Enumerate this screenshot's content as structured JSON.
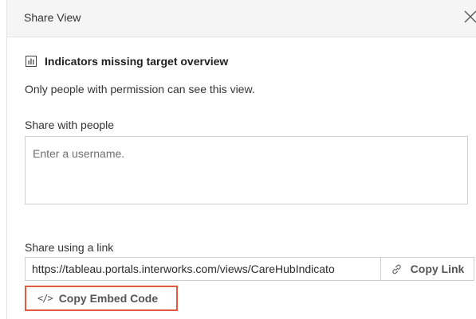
{
  "dialog": {
    "title": "Share View",
    "close_icon": "close-icon"
  },
  "view": {
    "icon": "bar-chart-icon",
    "title": "Indicators missing target overview"
  },
  "permission_note": "Only people with permission can see this view.",
  "share_people": {
    "label": "Share with people",
    "placeholder": "Enter a username."
  },
  "share_link": {
    "label": "Share using a link",
    "url": "https://tableau.portals.interworks.com/views/CareHubIndicato",
    "copy_link_label": "Copy Link",
    "copy_link_icon": "link-icon"
  },
  "embed": {
    "icon_glyph": "</>",
    "label": "Copy Embed Code",
    "highlight_color": "#e4593f"
  }
}
